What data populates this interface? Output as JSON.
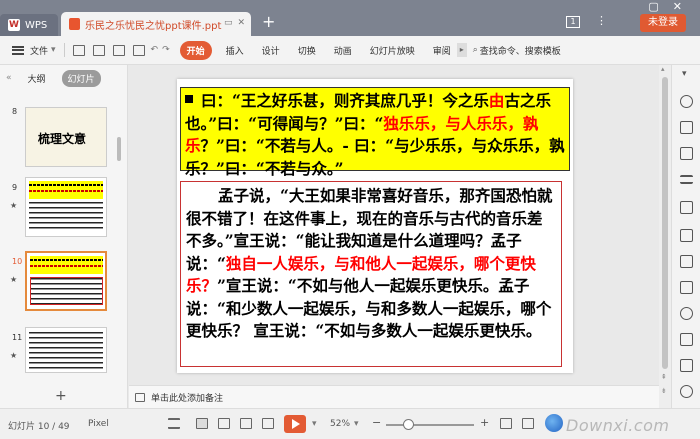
{
  "titlebar": {
    "app_tab": "WPS",
    "doc_tab": "乐民之乐忧民之忧ppt课件.ppt",
    "new_tab": "+",
    "badge": "1",
    "menu": "⋮",
    "login": "未登录"
  },
  "ribbon": {
    "file": "文件",
    "tabs": [
      "开始",
      "插入",
      "设计",
      "切换",
      "动画",
      "幻灯片放映",
      "审阅"
    ],
    "search": "查找命令、搜索模板"
  },
  "left_panel": {
    "tab_outline": "大纲",
    "tab_slides": "幻灯片",
    "thumbnails": [
      {
        "num": "8",
        "title": "梳理文意"
      },
      {
        "num": "9"
      },
      {
        "num": "10"
      },
      {
        "num": "11"
      }
    ],
    "add": "+"
  },
  "slide": {
    "yellow_part1": "曰：“王之好乐甚，则齐其庶几乎！今之乐",
    "yellow_red1": "由",
    "yellow_part2": "古之乐也。”曰：“可得闻与？”曰：“",
    "yellow_red2": "独乐乐，与人乐乐，孰乐",
    "yellow_part3": "？”曰：“不若与人。- 曰：“与少乐乐，与众乐乐，孰乐？”曰：“不若与众。”",
    "body_part1": "孟子说，“大王如果非常喜好音乐，那齐国恐怕就很不错了！在这件事上，现在的音乐与古代的音乐差不多。”宣王说：“能让我知道是什么道理吗？孟子说：“",
    "body_red": "独自一人娱乐，与和他人一起娱乐，哪个更快乐？",
    "body_part2": "”宣王说：“不如与他人一起娱乐更快乐。孟子说：“和少数人一起娱乐，与和多数人一起娱乐，哪个更快乐？ 宣王说：“不如与多数人一起娱乐更快乐。"
  },
  "notes": {
    "placeholder": "单击此处添加备注"
  },
  "status": {
    "slide_info": "幻灯片 10 / 49",
    "mode": "Pixel",
    "zoom": "52%",
    "zoom_minus": "−",
    "zoom_plus": "+",
    "watermark": "Downxi.com"
  }
}
